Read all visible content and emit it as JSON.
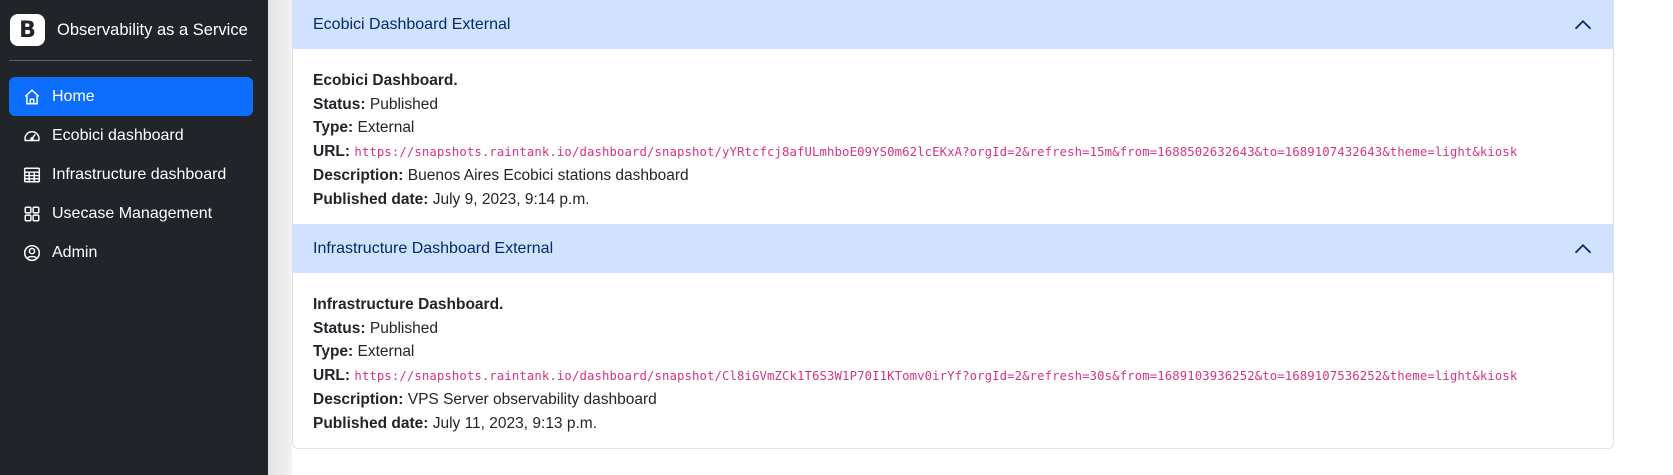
{
  "brand": {
    "logo_letter": "B",
    "name": "Observability as a Service"
  },
  "sidebar": {
    "items": [
      {
        "label": "Home",
        "icon": "home-icon",
        "active": true
      },
      {
        "label": "Ecobici dashboard",
        "icon": "speedometer-icon",
        "active": false
      },
      {
        "label": "Infrastructure dashboard",
        "icon": "table-icon",
        "active": false
      },
      {
        "label": "Usecase Management",
        "icon": "grid-icon",
        "active": false
      },
      {
        "label": "Admin",
        "icon": "person-circle-icon",
        "active": false
      }
    ]
  },
  "dashboards": [
    {
      "header": "Ecobici Dashboard External",
      "title": "Ecobici Dashboard.",
      "status_label": "Status:",
      "status": "Published",
      "type_label": "Type:",
      "type": "External",
      "url_label": "URL:",
      "url": "https://snapshots.raintank.io/dashboard/snapshot/yYRtcfcj8afULmhboE09YS0m62lcEKxA?orgId=2&refresh=15m&from=1688502632643&to=1689107432643&theme=light&kiosk",
      "description_label": "Description:",
      "description": "Buenos Aires Ecobici stations dashboard",
      "published_label": "Published date:",
      "published": "July 9, 2023, 9:14 p.m."
    },
    {
      "header": "Infrastructure Dashboard External",
      "title": "Infrastructure Dashboard.",
      "status_label": "Status:",
      "status": "Published",
      "type_label": "Type:",
      "type": "External",
      "url_label": "URL:",
      "url": "https://snapshots.raintank.io/dashboard/snapshot/Cl8iGVmZCk1T6S3W1P70I1KTomv0irYf?orgId=2&refresh=30s&from=1689103936252&to=1689107536252&theme=light&kiosk",
      "description_label": "Description:",
      "description": "VPS Server observability dashboard",
      "published_label": "Published date:",
      "published": "July 11, 2023, 9:13 p.m."
    }
  ],
  "colors": {
    "sidebar_bg": "#212529",
    "active_bg": "#0d6efd",
    "accordion_header_bg": "#cfe2ff",
    "accordion_header_text": "#052c65",
    "url_text": "#d63384"
  }
}
